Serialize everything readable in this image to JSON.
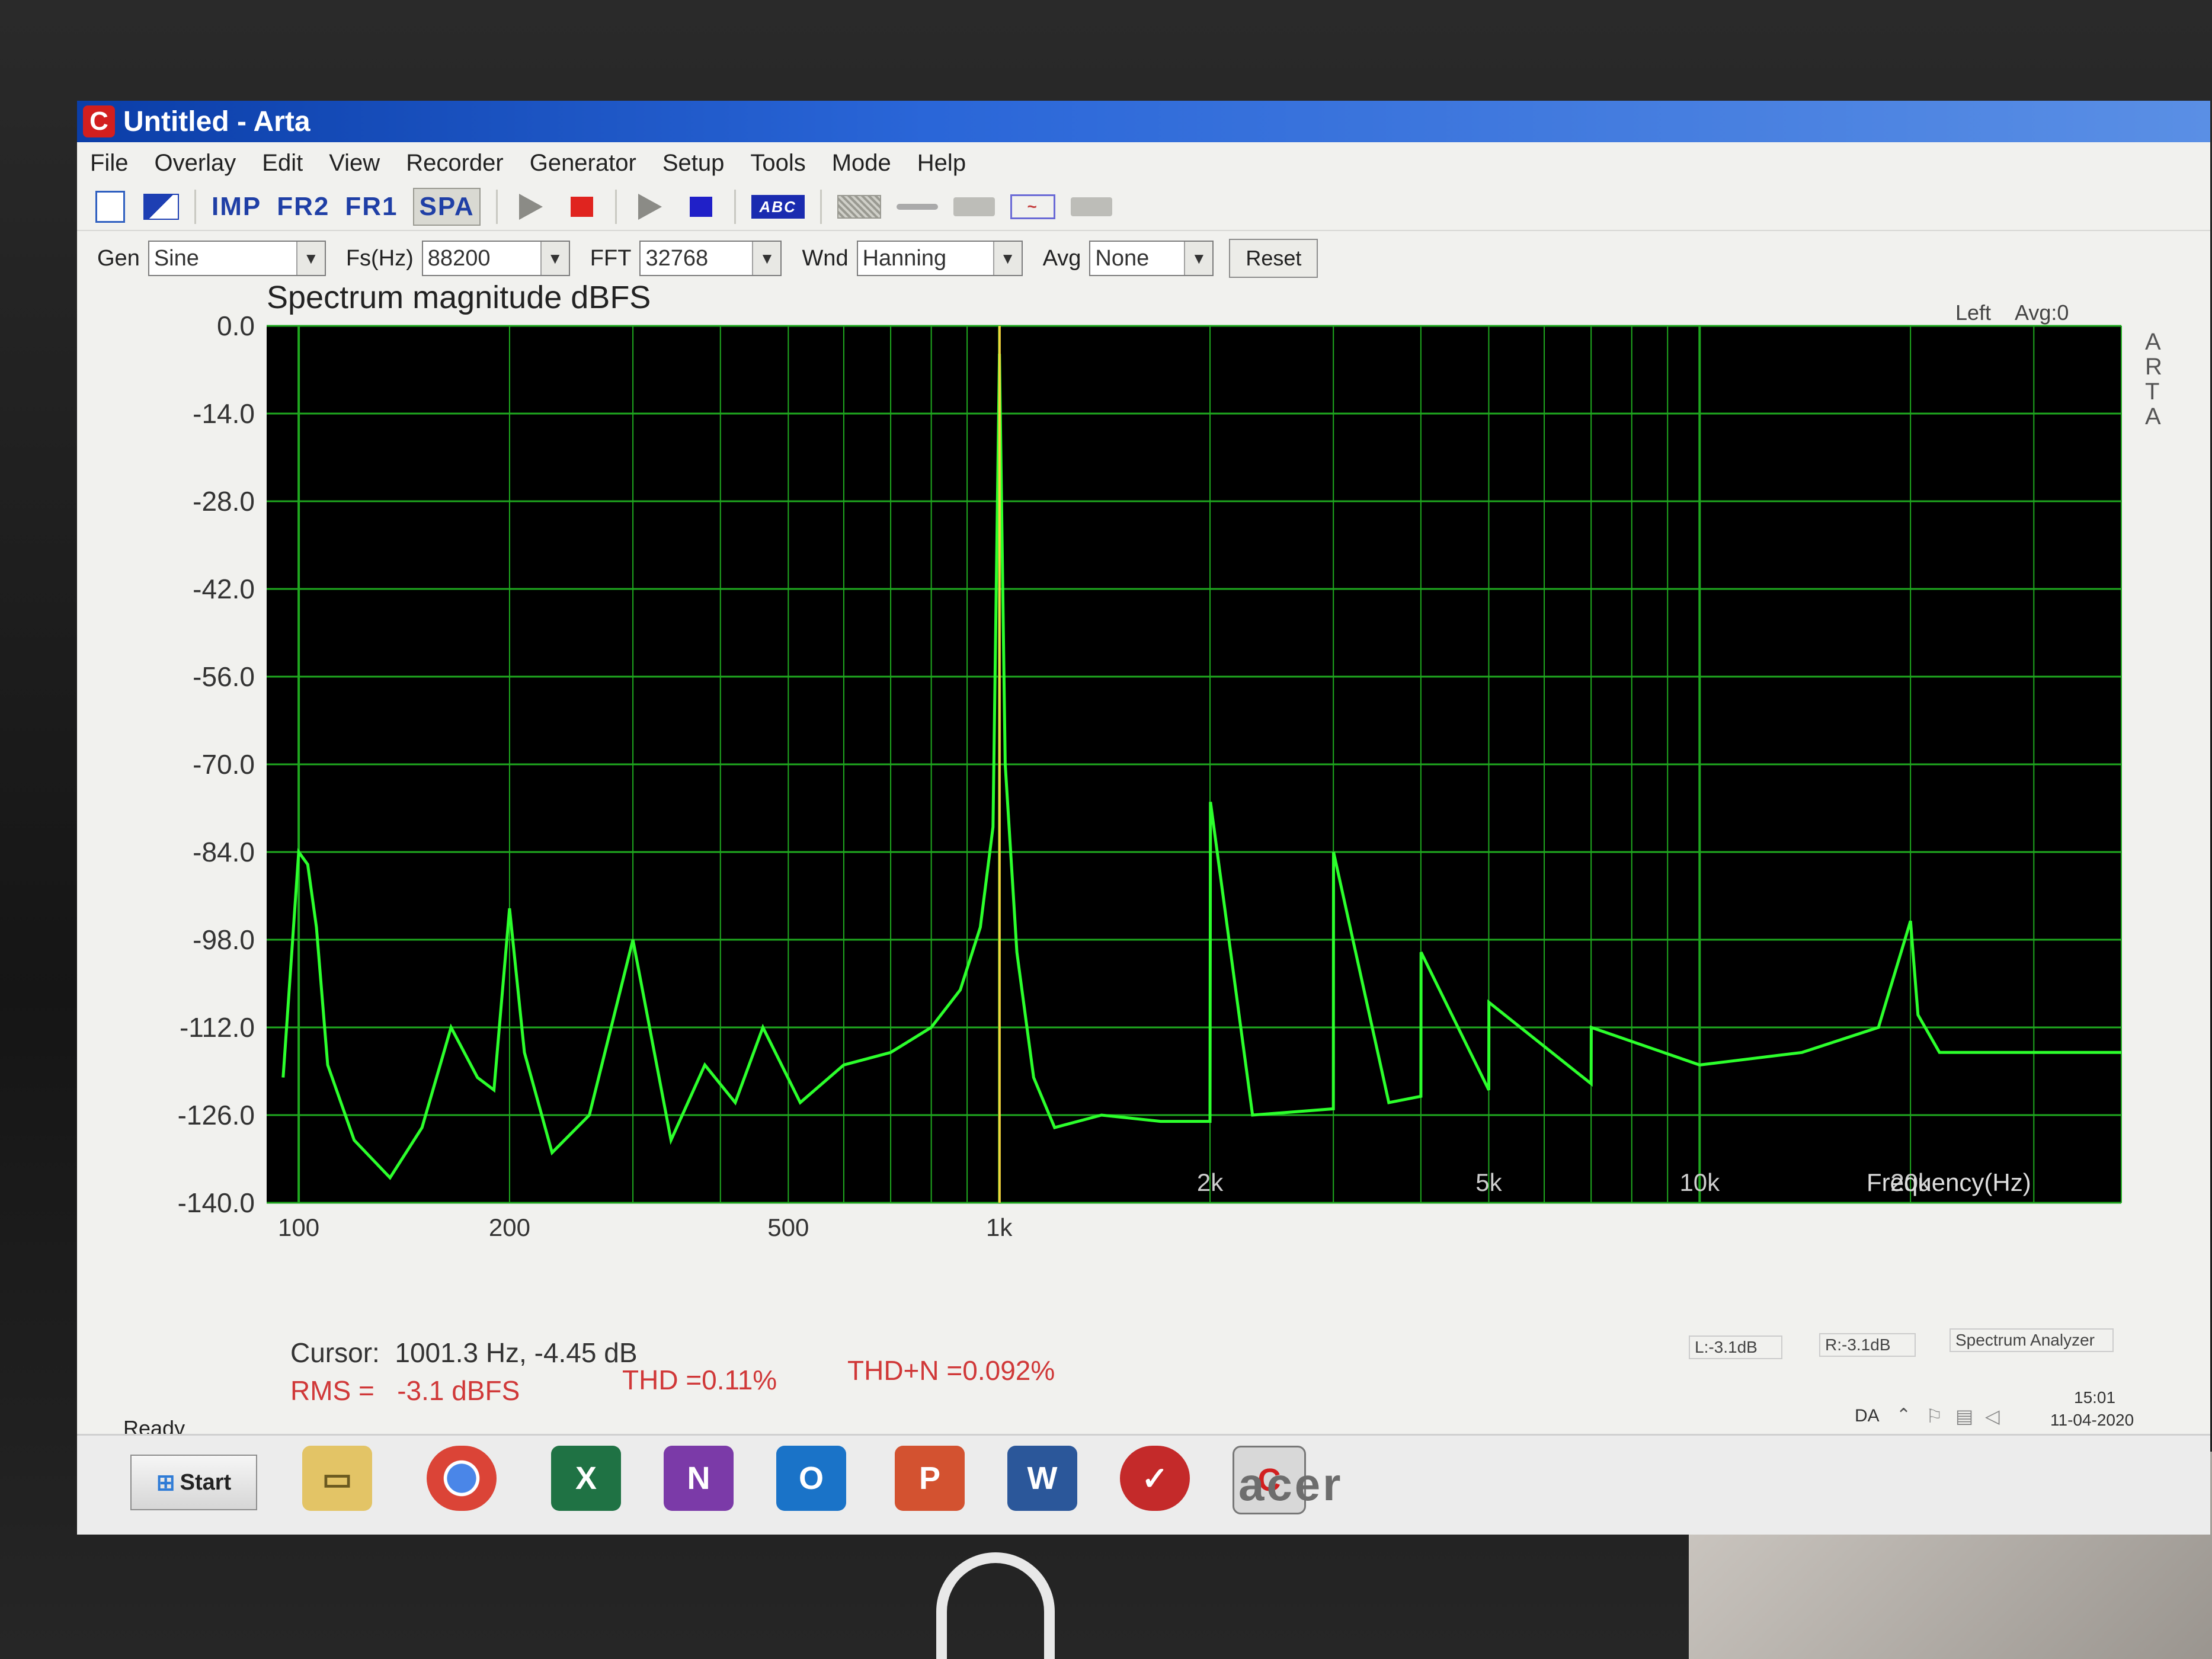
{
  "window": {
    "title": "Untitled - Arta",
    "logo_letter": "C"
  },
  "menu": [
    "File",
    "Overlay",
    "Edit",
    "View",
    "Recorder",
    "Generator",
    "Setup",
    "Tools",
    "Mode",
    "Help"
  ],
  "toolbar": {
    "imp": "IMP",
    "fr2": "FR2",
    "fr1": "FR1",
    "spa": "SPA",
    "abc": "ABC"
  },
  "controls": {
    "gen_label": "Gen",
    "gen_value": "Sine",
    "fs_label": "Fs(Hz)",
    "fs_value": "88200",
    "fft_label": "FFT",
    "fft_value": "32768",
    "wnd_label": "Wnd",
    "wnd_value": "Hanning",
    "avg_label": "Avg",
    "avg_value": "None",
    "reset_label": "Reset"
  },
  "chart_data": {
    "type": "line",
    "title": "Spectrum magnitude dBFS",
    "xlabel": "Frequency(Hz)",
    "x_scale": "log",
    "xlim": [
      90,
      40000
    ],
    "ylim": [
      -140,
      0
    ],
    "y_ticks": [
      "0.0",
      "-14.0",
      "-28.0",
      "-42.0",
      "-56.0",
      "-70.0",
      "-84.0",
      "-98.0",
      "-112.0",
      "-126.0",
      "-140.0"
    ],
    "x_ticks": [
      {
        "value": 100,
        "label": "100"
      },
      {
        "value": 200,
        "label": "200"
      },
      {
        "value": 500,
        "label": "500"
      },
      {
        "value": 1000,
        "label": "1k"
      },
      {
        "value": 2000,
        "label": "2k"
      },
      {
        "value": 5000,
        "label": "5k"
      },
      {
        "value": 10000,
        "label": "10k"
      },
      {
        "value": 20000,
        "label": "20k"
      }
    ],
    "grid": true,
    "channel_label": "Left",
    "avg_label": "Avg:0",
    "watermark": "ARTA",
    "background_color": "#000000",
    "grid_color": "#1fa81f",
    "trace_color": "#2cff2c",
    "cursor_color": "#f2d23c",
    "cursor_frequency": 1001.3,
    "series": [
      {
        "x": [
          95,
          100,
          103,
          106,
          110,
          120,
          135,
          150,
          165,
          180,
          190,
          200,
          210,
          230,
          260,
          300,
          340,
          380,
          420,
          460,
          520,
          600,
          700,
          800,
          880,
          940,
          980,
          1001,
          1020,
          1060,
          1120,
          1200,
          1400,
          1700,
          2000,
          2003,
          2300,
          3000,
          3002,
          3600,
          4000,
          4002,
          5000,
          5002,
          7000,
          7003,
          10000,
          14000,
          18000,
          20000,
          20500,
          22000,
          28000,
          40000
        ],
        "y": [
          -120,
          -84,
          -86,
          -96,
          -118,
          -130,
          -136,
          -128,
          -112,
          -120,
          -122,
          -93,
          -116,
          -132,
          -126,
          -98,
          -130,
          -118,
          -124,
          -112,
          -124,
          -118,
          -116,
          -112,
          -106,
          -96,
          -80,
          -4.45,
          -70,
          -100,
          -120,
          -128,
          -126,
          -127,
          -127,
          -76,
          -126,
          -125,
          -84,
          -124,
          -123,
          -100,
          -122,
          -108,
          -121,
          -112,
          -118,
          -116,
          -112,
          -95,
          -110,
          -116,
          -116,
          -116
        ]
      }
    ]
  },
  "readouts": {
    "cursor": "Cursor:  1001.3 Hz, -4.45 dB",
    "rms": "RMS =   -3.1 dBFS",
    "thd": "THD =0.11%",
    "thdn": "THD+N =0.092%",
    "left_level": "L:-3.1dB",
    "right_level": "R:-3.1dB",
    "mode": "Spectrum Analyzer",
    "status": "Ready"
  },
  "taskbar": {
    "start": "Start",
    "lang": "DA",
    "time": "15:01",
    "date": "11-04-2020",
    "apps": [
      "file-explorer",
      "chrome",
      "excel",
      "onenote",
      "outlook",
      "powerpoint",
      "word",
      "ev-app",
      "arta"
    ]
  },
  "monitor_brand": "acer"
}
